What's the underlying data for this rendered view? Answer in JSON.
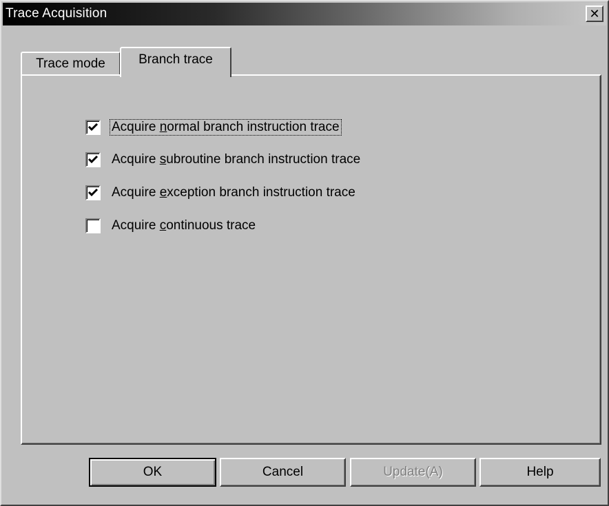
{
  "window": {
    "title": "Trace Acquisition",
    "close_glyph": "✕"
  },
  "tabs": [
    {
      "label": "Trace mode",
      "active": false
    },
    {
      "label": "Branch trace",
      "active": true
    }
  ],
  "checkboxes": [
    {
      "prefix": "Acquire ",
      "mnemonic": "n",
      "suffix": "ormal branch instruction trace",
      "checked": true
    },
    {
      "prefix": "Acquire ",
      "mnemonic": "s",
      "suffix": "ubroutine branch instruction trace",
      "checked": true
    },
    {
      "prefix": "Acquire ",
      "mnemonic": "e",
      "suffix": "xception branch instruction trace",
      "checked": true
    },
    {
      "prefix": "Acquire ",
      "mnemonic": "c",
      "suffix": "ontinuous trace",
      "checked": false
    }
  ],
  "buttons": {
    "ok": "OK",
    "cancel": "Cancel",
    "update": "Update(A)",
    "help": "Help"
  }
}
